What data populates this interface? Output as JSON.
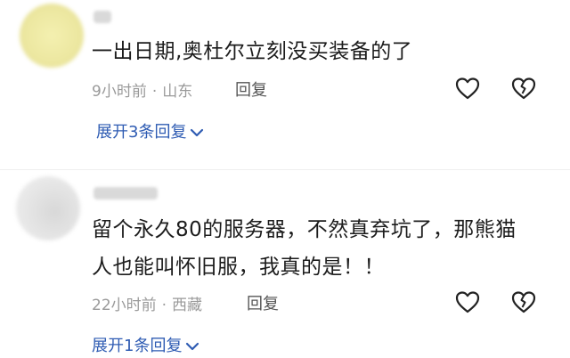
{
  "comments": [
    {
      "text_lines": [
        "一出日期,奥杜尔立刻没买装备的了"
      ],
      "time": "9小时前",
      "location": "山东",
      "reply_label": "回复",
      "expand_label": "展开3条回复"
    },
    {
      "text_lines": [
        "留个永久80的服务器，不然真弃坑了，那熊猫",
        "人也能叫怀旧服，我真的是！！"
      ],
      "time": "22小时前",
      "location": "西藏",
      "reply_label": "回复",
      "expand_label": "展开1条回复"
    }
  ],
  "icons": {
    "like": "heart-outline-icon",
    "dislike": "broken-heart-icon",
    "expand": "chevron-down-icon"
  },
  "colors": {
    "link": "#2f5cb3",
    "meta": "#9a9a9a",
    "icon": "#222222"
  }
}
